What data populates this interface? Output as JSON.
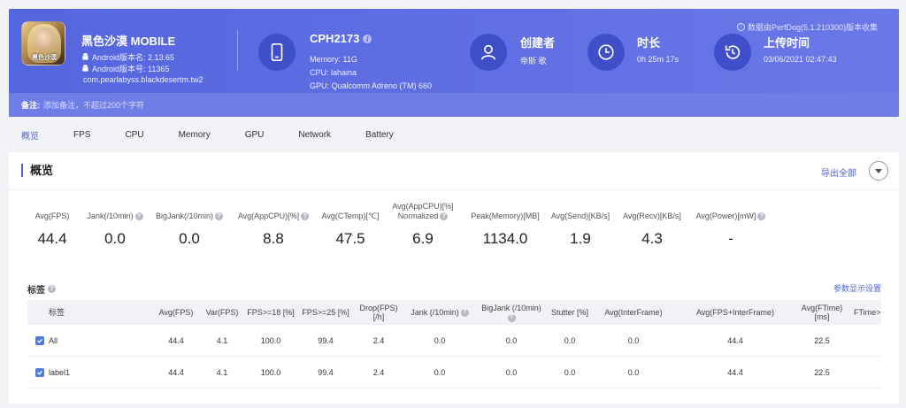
{
  "header": {
    "app_name": "黑色沙漠 MOBILE",
    "game_icon_text": "黑色沙漠",
    "android_version_name": "Android版本名: 2.13.65",
    "android_version_code": "Android版本号: 11365",
    "package": "com.pearlabyss.blackdesertm.tw2",
    "device_name": "CPH2173",
    "memory": "Memory: 11G",
    "cpu": "CPU: lahaina",
    "gpu": "GPU: Qualcomm Adreno (TM) 660",
    "creator_title": "创建者",
    "creator_value": "帝斯 歌",
    "duration_title": "时长",
    "duration_value": "0h 25m 17s",
    "upload_title": "上传时间",
    "upload_value": "03/06/2021 02:47:43",
    "perfdog_note": "数据由PerfDog(5.1.210300)版本收集",
    "note_label": "备注:",
    "note_placeholder": "添加备注，不超过200个字符",
    "colors": {
      "header_bg": "#5a6ce0",
      "icon_circle": "#3f4fc9"
    }
  },
  "tabs": [
    {
      "label": "概览",
      "active": true
    },
    {
      "label": "FPS"
    },
    {
      "label": "CPU"
    },
    {
      "label": "Memory"
    },
    {
      "label": "GPU"
    },
    {
      "label": "Network"
    },
    {
      "label": "Battery"
    }
  ],
  "overview": {
    "title": "概览",
    "export_label": "导出全部",
    "metrics": [
      {
        "label": "Avg(FPS)",
        "value": "44.4"
      },
      {
        "label": "Jank(/10min)",
        "value": "0.0",
        "help": true
      },
      {
        "label": "BigJank(/10min)",
        "value": "0.0",
        "help": true
      },
      {
        "label": "Avg(AppCPU)[%]",
        "value": "8.8",
        "help": true
      },
      {
        "label": "Avg(CTemp)[℃]",
        "value": "47.5"
      },
      {
        "label": "Avg(AppCPU)[%]",
        "label2": "Normalized",
        "value": "6.9",
        "help": true
      },
      {
        "label": "Peak(Memory)[MB]",
        "value": "1134.0"
      },
      {
        "label": "Avg(Send)[KB/s]",
        "value": "1.9"
      },
      {
        "label": "Avg(Recv)[KB/s]",
        "value": "4.3"
      },
      {
        "label": "Avg(Power)[mW]",
        "value": "-",
        "help": true
      }
    ]
  },
  "tags": {
    "title": "标签",
    "param_settings": "参数显示设置",
    "columns": [
      "标签",
      "Avg(FPS)",
      "Var(FPS)",
      "FPS>=18 [%]",
      "FPS>=25 [%]",
      "Drop(FPS) [/h]",
      "Jank (/10min)",
      "BigJank (/10min)",
      "Stutter [%]",
      "Avg(InterFrame)",
      "Avg(FPS+InterFrame)",
      "Avg(FTime) [ms]",
      "FTime>"
    ],
    "rows": [
      {
        "name": "All",
        "values": [
          "44.4",
          "4.1",
          "100.0",
          "99.4",
          "2.4",
          "0.0",
          "0.0",
          "0.0",
          "0.0",
          "44.4",
          "22.5"
        ]
      },
      {
        "name": "label1",
        "values": [
          "44.4",
          "4.1",
          "100.0",
          "99.4",
          "2.4",
          "0.0",
          "0.0",
          "0.0",
          "0.0",
          "44.4",
          "22.5"
        ]
      }
    ]
  }
}
